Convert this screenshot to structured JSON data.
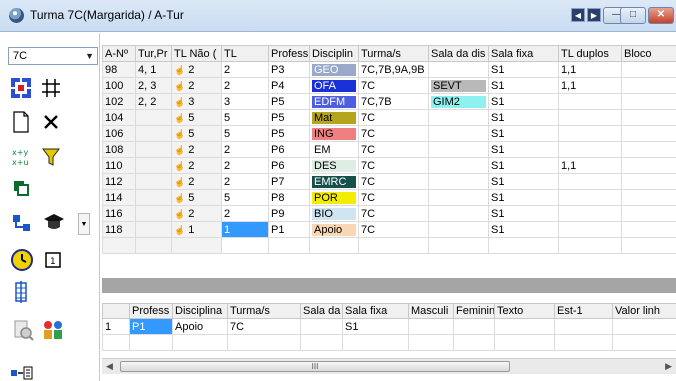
{
  "window": {
    "title": "Turma 7C(Margarida) / A-Tur",
    "nav_prev": "◀",
    "nav_next": "▶",
    "minimize": "—",
    "maximize": "□",
    "close": "✕"
  },
  "sidebar": {
    "class_select": "7C"
  },
  "colors": {
    "GEO": "#9aa8c9",
    "OFA": "#1a2fd8",
    "EDFM": "#4d5fe0",
    "Mat": "#b5a51a",
    "ING": "#f08080",
    "DES": "#dfeee4",
    "EMRC": "#17504b",
    "POR": "#f5ed00",
    "BIO": "#cfe6f2",
    "Apoio": "#f9d7b4",
    "SEVT": "#b9b9b9",
    "GIM2": "#8ef0ef",
    "selection": "#3399ff"
  },
  "main_grid": {
    "headers": [
      "A-Nº",
      "Tur,Pr",
      "TL Não (",
      "TL",
      "Profess",
      "Disciplin",
      "Turma/s",
      "Sala da dis",
      "Sala fixa",
      "TL duplos",
      "Bloco"
    ],
    "rows": [
      {
        "n": "98",
        "tur": "4, 1",
        "tlnao": "2",
        "tl": "2",
        "prof": "P3",
        "disc": "GEO",
        "turmas": "7C,7B,9A,9B",
        "sala": "",
        "fixa": "S1",
        "duplos": "1,1",
        "bloco": ""
      },
      {
        "n": "100",
        "tur": "2, 3",
        "tlnao": "2",
        "tl": "2",
        "prof": "P4",
        "disc": "OFA",
        "turmas": "7C",
        "sala": "SEVT",
        "fixa": "S1",
        "duplos": "1,1",
        "bloco": ""
      },
      {
        "n": "102",
        "tur": "2, 2",
        "tlnao": "3",
        "tl": "3",
        "prof": "P5",
        "disc": "EDFM",
        "turmas": "7C,7B",
        "sala": "GIM2",
        "fixa": "S1",
        "duplos": "",
        "bloco": ""
      },
      {
        "n": "104",
        "tur": "",
        "tlnao": "5",
        "tl": "5",
        "prof": "P5",
        "disc": "Mat",
        "turmas": "7C",
        "sala": "",
        "fixa": "S1",
        "duplos": "",
        "bloco": ""
      },
      {
        "n": "106",
        "tur": "",
        "tlnao": "5",
        "tl": "5",
        "prof": "P5",
        "disc": "ING",
        "turmas": "7C",
        "sala": "",
        "fixa": "S1",
        "duplos": "",
        "bloco": ""
      },
      {
        "n": "108",
        "tur": "",
        "tlnao": "2",
        "tl": "2",
        "prof": "P6",
        "disc": "EM",
        "turmas": "7C",
        "sala": "",
        "fixa": "S1",
        "duplos": "",
        "bloco": ""
      },
      {
        "n": "110",
        "tur": "",
        "tlnao": "2",
        "tl": "2",
        "prof": "P6",
        "disc": "DES",
        "turmas": "7C",
        "sala": "",
        "fixa": "S1",
        "duplos": "1,1",
        "bloco": ""
      },
      {
        "n": "112",
        "tur": "",
        "tlnao": "2",
        "tl": "2",
        "prof": "P7",
        "disc": "EMRC",
        "turmas": "7C",
        "sala": "",
        "fixa": "S1",
        "duplos": "",
        "bloco": ""
      },
      {
        "n": "114",
        "tur": "",
        "tlnao": "5",
        "tl": "5",
        "prof": "P8",
        "disc": "POR",
        "turmas": "7C",
        "sala": "",
        "fixa": "S1",
        "duplos": "",
        "bloco": ""
      },
      {
        "n": "116",
        "tur": "",
        "tlnao": "2",
        "tl": "2",
        "prof": "P9",
        "disc": "BIO",
        "turmas": "7C",
        "sala": "",
        "fixa": "S1",
        "duplos": "",
        "bloco": ""
      },
      {
        "n": "118",
        "tur": "",
        "tlnao": "1",
        "tl": "1",
        "prof": "P1",
        "disc": "Apoio",
        "turmas": "7C",
        "sala": "",
        "fixa": "S1",
        "duplos": "",
        "bloco": ""
      }
    ]
  },
  "lower_grid": {
    "headers": [
      "",
      "Profess",
      "Disciplina",
      "Turma/s",
      "Sala da",
      "Sala fixa",
      "Masculi",
      "Feminin",
      "Texto",
      "Est-1",
      "Valor linh"
    ],
    "rows": [
      {
        "n": "1",
        "prof": "P1",
        "disc": "Apoio",
        "turmas": "7C",
        "sala": "",
        "fixa": "S1",
        "masc": "",
        "fem": "",
        "texto": "",
        "est": "",
        "valor": ""
      }
    ]
  },
  "scrollbar": {
    "left_arrow": "◀",
    "right_arrow": "▶",
    "grip": "III"
  }
}
